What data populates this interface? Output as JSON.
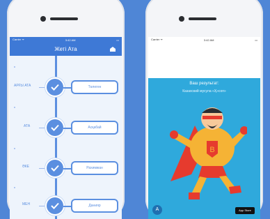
{
  "left_phone": {
    "status": {
      "carrier": "Carrier ᯤ",
      "time": "3:42 AM"
    },
    "nav_title": "Жеті Ата",
    "rows": [
      {
        "label": "АРҒЫ АТА",
        "box": "Төлеген"
      },
      {
        "label": "АТА",
        "box": "Асқабай"
      },
      {
        "label": "ӘКЕ",
        "box": "Рахимжан"
      },
      {
        "label": "МЕН",
        "box": "Данияр"
      }
    ]
  },
  "right_phone": {
    "status": {
      "carrier": "Carrier ᯤ",
      "time": "3:42 AM"
    },
    "result_title": "Ваш результат:",
    "result_subtitle": "Казахский мусула «Ҳ»соп»",
    "app_icon_letter": "A",
    "store_badge": "App Store"
  },
  "colors": {
    "background": "#4f86d6",
    "accent": "#3e79d6",
    "tree_line": "#5b8fe0",
    "result_bg": "#2fa9dc"
  }
}
